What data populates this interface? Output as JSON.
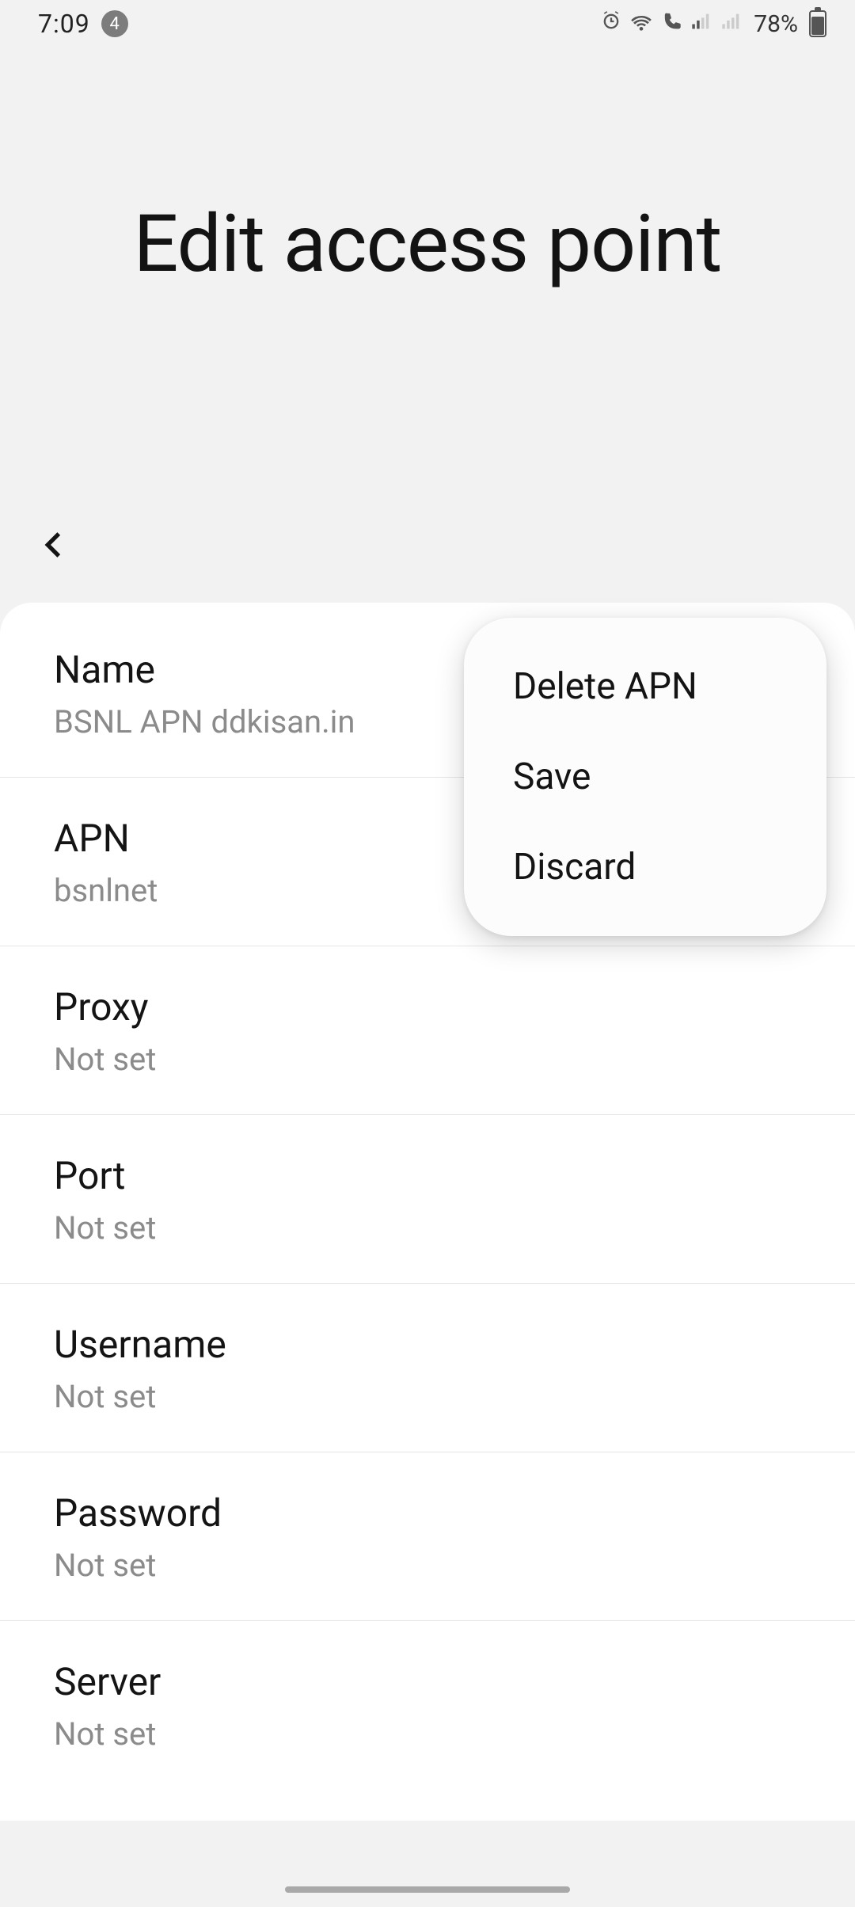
{
  "status": {
    "time": "7:09",
    "notif_count": "4",
    "battery_pct": "78%"
  },
  "page": {
    "title": "Edit access point"
  },
  "popup": {
    "delete": "Delete APN",
    "save": "Save",
    "discard": "Discard"
  },
  "fields": [
    {
      "label": "Name",
      "value": "BSNL APN ddkisan.in"
    },
    {
      "label": "APN",
      "value": "bsnlnet"
    },
    {
      "label": "Proxy",
      "value": "Not set"
    },
    {
      "label": "Port",
      "value": "Not set"
    },
    {
      "label": "Username",
      "value": "Not set"
    },
    {
      "label": "Password",
      "value": "Not set"
    },
    {
      "label": "Server",
      "value": "Not set"
    }
  ]
}
